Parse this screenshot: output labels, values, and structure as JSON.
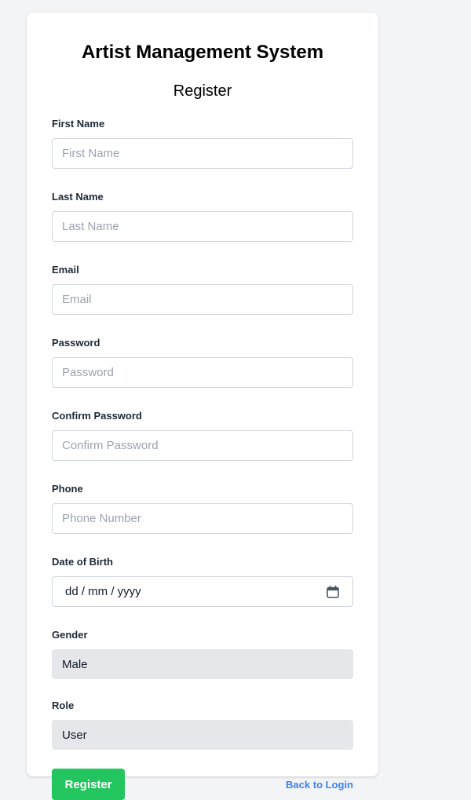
{
  "app_title": "Artist Management System",
  "form_title": "Register",
  "fields": {
    "first_name": {
      "label": "First Name",
      "placeholder": "First Name",
      "value": ""
    },
    "last_name": {
      "label": "Last Name",
      "placeholder": "Last Name",
      "value": ""
    },
    "email": {
      "label": "Email",
      "placeholder": "Email",
      "value": ""
    },
    "password": {
      "label": "Password",
      "placeholder": "Password",
      "value": ""
    },
    "confirm_password": {
      "label": "Confirm Password",
      "placeholder": "Confirm Password",
      "value": ""
    },
    "phone": {
      "label": "Phone",
      "placeholder": "Phone Number",
      "value": ""
    },
    "dob": {
      "label": "Date of Birth",
      "format_text": "dd / mm / yyyy",
      "icon": "calendar-icon"
    },
    "gender": {
      "label": "Gender",
      "selected": "Male"
    },
    "role": {
      "label": "Role",
      "selected": "User"
    }
  },
  "actions": {
    "register_label": "Register",
    "back_link_label": "Back to Login"
  },
  "colors": {
    "page_background": "#f3f4f6",
    "card_background": "#ffffff",
    "input_border": "#d1d5db",
    "select_background": "#e5e7eb",
    "placeholder_text": "#9ca3af",
    "label_text": "#1f2937",
    "primary_button": "#22c55e",
    "link": "#3b82f6"
  }
}
